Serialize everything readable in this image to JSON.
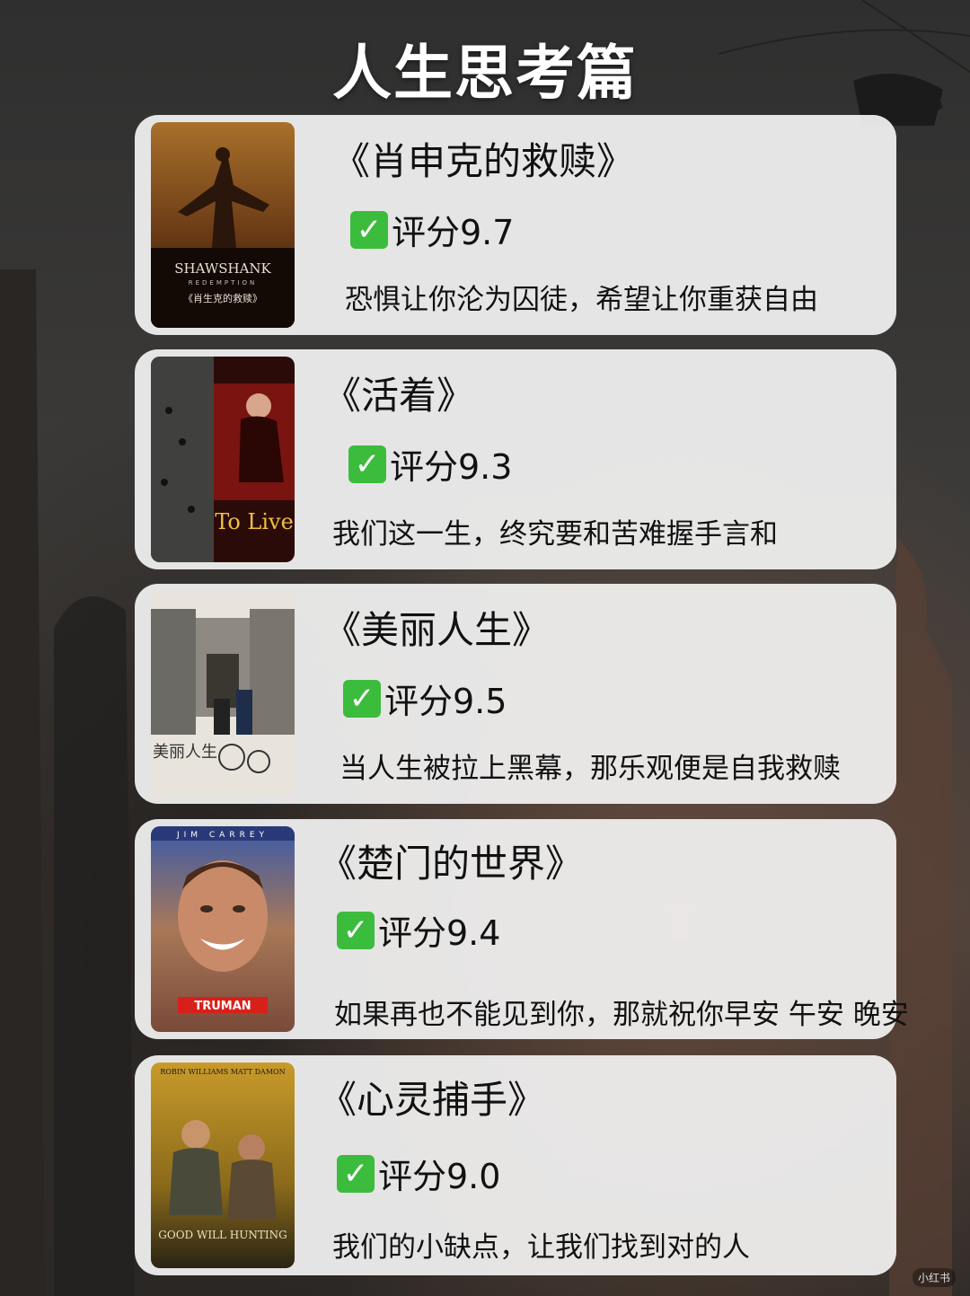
{
  "page": {
    "title": "人生思考篇"
  },
  "check_icon": "✓",
  "cards": [
    {
      "title": "《肖申克的救赎》",
      "rating": "评分9.7",
      "quote": "恐惧让你沦为囚徒，希望让你重获自由",
      "poster": {
        "line1": "SHAWSHANK",
        "line2": "REDEMPTION",
        "line3": "《肖生克的救赎》",
        "icon": "shawshank-poster"
      }
    },
    {
      "title": "《活着》",
      "rating": "评分9.3",
      "quote": "我们这一生，终究要和苦难握手言和",
      "poster": {
        "line1": "To Live",
        "icon": "to-live-poster"
      }
    },
    {
      "title": "《美丽人生》",
      "rating": "评分9.5",
      "quote": "当人生被拉上黑幕，那乐观便是自我救赎",
      "poster": {
        "line1": "美丽人生",
        "icon": "life-is-beautiful-poster"
      }
    },
    {
      "title": "《楚门的世界》",
      "rating": "评分9.4",
      "quote": "如果再也不能见到你，那就祝你早安 午安 晚安",
      "poster": {
        "line1": "JIM CARREY",
        "line2": "TRUMAN",
        "icon": "truman-show-poster"
      }
    },
    {
      "title": "《心灵捕手》",
      "rating": "评分9.0",
      "quote": "我们的小缺点，让我们找到对的人",
      "poster": {
        "line1": "ROBIN WILLIAMS   MATT DAMON",
        "line2": "GOOD WILL HUNTING",
        "icon": "good-will-hunting-poster"
      }
    }
  ],
  "watermark": "小红书"
}
